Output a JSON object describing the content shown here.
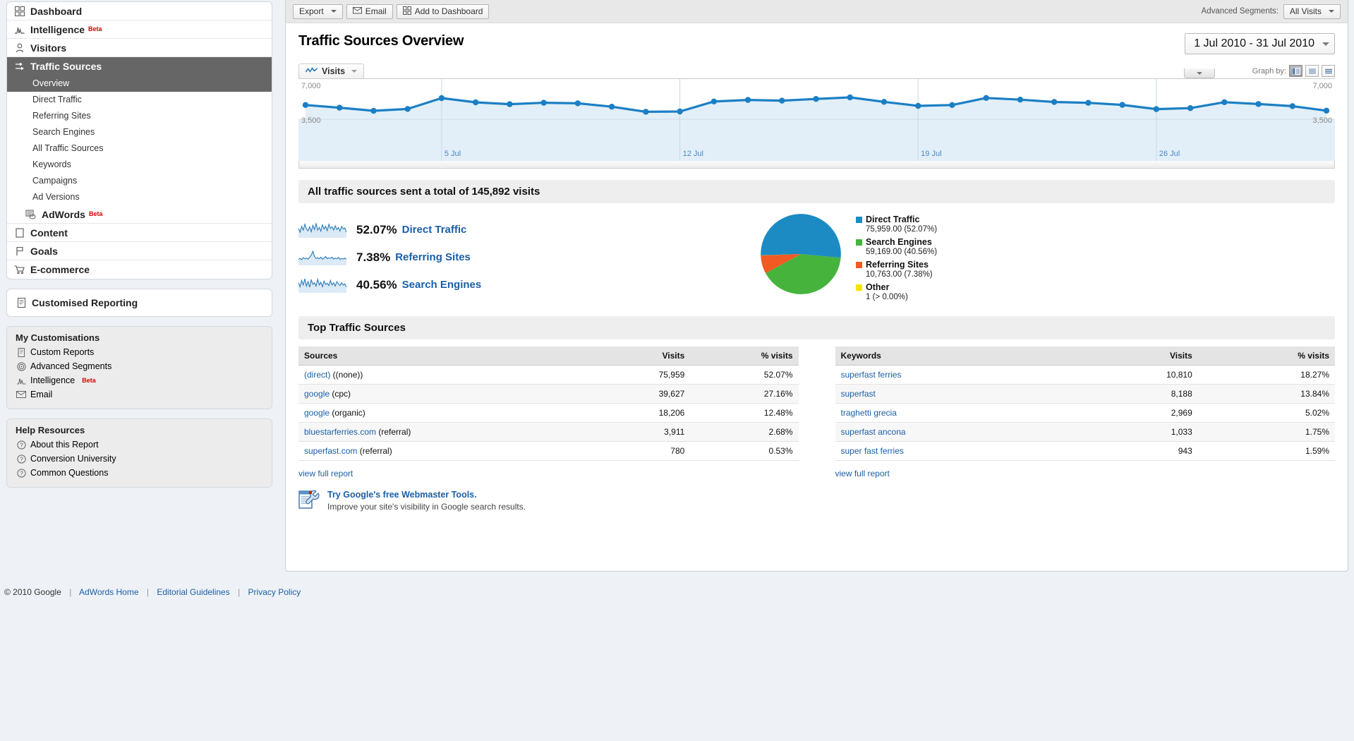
{
  "sidebar": {
    "nav": [
      {
        "label": "Dashboard",
        "icon": "dashboard-icon",
        "beta": ""
      },
      {
        "label": "Intelligence",
        "icon": "intelligence-icon",
        "beta": "Beta"
      },
      {
        "label": "Visitors",
        "icon": "visitors-icon",
        "beta": ""
      },
      {
        "label": "Traffic Sources",
        "icon": "traffic-sources-icon",
        "beta": ""
      }
    ],
    "subnav": [
      "Overview",
      "Direct Traffic",
      "Referring Sites",
      "Search Engines",
      "All Traffic Sources",
      "Keywords",
      "Campaigns",
      "Ad Versions"
    ],
    "adwords": {
      "label": "AdWords",
      "beta": "Beta",
      "icon": "adwords-icon"
    },
    "nav_lower": [
      {
        "label": "Content",
        "icon": "content-icon",
        "beta": ""
      },
      {
        "label": "Goals",
        "icon": "goals-flag-icon",
        "beta": ""
      },
      {
        "label": "E-commerce",
        "icon": "ecommerce-cart-icon",
        "beta": ""
      }
    ],
    "customised_reporting": {
      "label": "Customised Reporting",
      "icon": "report-icon"
    },
    "my_customisations": {
      "title": "My Customisations",
      "items": [
        {
          "label": "Custom Reports",
          "icon": "report-icon",
          "beta": ""
        },
        {
          "label": "Advanced Segments",
          "icon": "target-icon",
          "beta": ""
        },
        {
          "label": "Intelligence",
          "icon": "intelligence-icon",
          "beta": "Beta"
        },
        {
          "label": "Email",
          "icon": "envelope-icon",
          "beta": ""
        }
      ]
    },
    "help_resources": {
      "title": "Help Resources",
      "items": [
        {
          "label": "About this Report",
          "icon": "question-icon"
        },
        {
          "label": "Conversion University",
          "icon": "question-icon"
        },
        {
          "label": "Common Questions",
          "icon": "question-icon"
        }
      ]
    }
  },
  "toolbar": {
    "export_label": "Export",
    "email_label": "Email",
    "add_to_dashboard_label": "Add to Dashboard",
    "advanced_segments_label": "Advanced Segments:",
    "advanced_segments_value": "All Visits"
  },
  "report": {
    "title": "Traffic Sources Overview",
    "date_range": "1 Jul 2010 - 31 Jul 2010"
  },
  "chart_controls": {
    "metric_label": "Visits",
    "graph_by_label": "Graph by:",
    "graph_by_options": [
      "day",
      "week",
      "month"
    ],
    "graph_by_selected": "day"
  },
  "overview": {
    "summary_heading": "All traffic sources sent a total of 145,892 visits",
    "rows": [
      {
        "pct": "52.07%",
        "name": "Direct Traffic"
      },
      {
        "pct": "7.38%",
        "name": "Referring Sites"
      },
      {
        "pct": "40.56%",
        "name": "Search Engines"
      }
    ],
    "legend": [
      {
        "name": "Direct Traffic",
        "value": "75,959.00 (52.07%)",
        "color": "#1c8bc4"
      },
      {
        "name": "Search Engines",
        "value": "59,169.00 (40.56%)",
        "color": "#46b43c"
      },
      {
        "name": "Referring Sites",
        "value": "10,763.00 (7.38%)",
        "color": "#f15a22"
      },
      {
        "name": "Other",
        "value": "1 (> 0.00%)",
        "color": "#f2e500"
      }
    ]
  },
  "top_sources": {
    "heading": "Top Traffic Sources",
    "sources_table": {
      "headers": [
        "Sources",
        "Visits",
        "% visits"
      ],
      "rows": [
        {
          "link": "(direct)",
          "suffix": " ((none))",
          "visits": "75,959",
          "pct": "52.07%"
        },
        {
          "link": "google",
          "suffix": " (cpc)",
          "visits": "39,627",
          "pct": "27.16%"
        },
        {
          "link": "google",
          "suffix": " (organic)",
          "visits": "18,206",
          "pct": "12.48%"
        },
        {
          "link": "bluestarferries.com",
          "suffix": " (referral)",
          "visits": "3,911",
          "pct": "2.68%"
        },
        {
          "link": "superfast.com",
          "suffix": " (referral)",
          "visits": "780",
          "pct": "0.53%"
        }
      ],
      "view_full_report": "view full report"
    },
    "keywords_table": {
      "headers": [
        "Keywords",
        "Visits",
        "% visits"
      ],
      "rows": [
        {
          "link": "superfast ferries",
          "suffix": "",
          "visits": "10,810",
          "pct": "18.27%"
        },
        {
          "link": "superfast",
          "suffix": "",
          "visits": "8,188",
          "pct": "13.84%"
        },
        {
          "link": "traghetti grecia",
          "suffix": "",
          "visits": "2,969",
          "pct": "5.02%"
        },
        {
          "link": "superfast ancona",
          "suffix": "",
          "visits": "1,033",
          "pct": "1.75%"
        },
        {
          "link": "super fast ferries",
          "suffix": "",
          "visits": "943",
          "pct": "1.59%"
        }
      ],
      "view_full_report": "view full report"
    }
  },
  "promo": {
    "title": "Try Google's free Webmaster Tools.",
    "subtitle": "Improve your site's visibility in Google search results."
  },
  "footer": {
    "copyright": "© 2010 Google",
    "links": [
      "AdWords Home",
      "Editorial Guidelines",
      "Privacy Policy"
    ]
  },
  "chart_data": {
    "type": "line",
    "title": "Visits",
    "xlabel": "",
    "ylabel": "Visits",
    "ylim": [
      0,
      7000
    ],
    "ytick_labels": [
      "7,000",
      "3,500"
    ],
    "ytick_values": [
      7000,
      3500
    ],
    "grid": true,
    "legend_position": "none",
    "line_color": "#1b7fc4",
    "fill_color": "#e2eff9",
    "x": [
      "1 Jul",
      "2 Jul",
      "3 Jul",
      "4 Jul",
      "5 Jul",
      "6 Jul",
      "7 Jul",
      "8 Jul",
      "9 Jul",
      "10 Jul",
      "11 Jul",
      "12 Jul",
      "13 Jul",
      "14 Jul",
      "15 Jul",
      "16 Jul",
      "17 Jul",
      "18 Jul",
      "19 Jul",
      "20 Jul",
      "21 Jul",
      "22 Jul",
      "23 Jul",
      "24 Jul",
      "25 Jul",
      "26 Jul",
      "27 Jul",
      "28 Jul",
      "29 Jul",
      "30 Jul",
      "31 Jul"
    ],
    "xtick_labels": [
      "5 Jul",
      "12 Jul",
      "19 Jul",
      "26 Jul"
    ],
    "xtick_indices": [
      4,
      11,
      18,
      25
    ],
    "values": [
      5180,
      4870,
      4500,
      4720,
      6000,
      5500,
      5280,
      5450,
      5380,
      4980,
      4380,
      4420,
      5600,
      5780,
      5700,
      5900,
      6080,
      5560,
      5080,
      5180,
      6020,
      5820,
      5540,
      5440,
      5200,
      4700,
      4820,
      5520,
      5300,
      5050,
      4520
    ]
  },
  "sparkline_data": [
    {
      "name": "Direct Traffic",
      "values": [
        55,
        40,
        62,
        48,
        70,
        52,
        45,
        60,
        42,
        66,
        50,
        72,
        48,
        58,
        44,
        68,
        52,
        62,
        46,
        70,
        54,
        60,
        48,
        64,
        50,
        58,
        44,
        62,
        52,
        56,
        40
      ]
    },
    {
      "name": "Referring Sites",
      "values": [
        45,
        50,
        42,
        55,
        48,
        52,
        46,
        58,
        70,
        95,
        62,
        50,
        55,
        48,
        58,
        44,
        52,
        62,
        48,
        54,
        50,
        58,
        46,
        52,
        48,
        56,
        44,
        50,
        46,
        52,
        44
      ]
    },
    {
      "name": "Search Engines",
      "values": [
        58,
        44,
        66,
        50,
        72,
        46,
        62,
        42,
        68,
        52,
        58,
        46,
        70,
        50,
        60,
        44,
        64,
        52,
        56,
        48,
        66,
        50,
        58,
        46,
        62,
        54,
        48,
        58,
        50,
        54,
        42
      ]
    }
  ],
  "pie_data": {
    "type": "pie",
    "labels": [
      "Direct Traffic",
      "Search Engines",
      "Referring Sites",
      "Other"
    ],
    "values": [
      75959,
      59169,
      10763,
      1
    ],
    "percents": [
      52.07,
      40.56,
      7.38,
      0.0
    ],
    "colors": [
      "#1c8bc4",
      "#46b43c",
      "#f15a22",
      "#f2e500"
    ]
  }
}
